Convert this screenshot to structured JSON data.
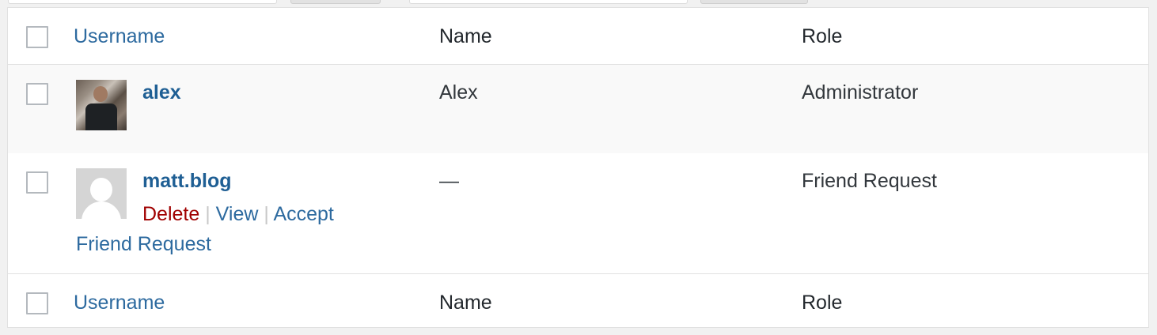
{
  "columns": {
    "username": "Username",
    "name": "Name",
    "role": "Role"
  },
  "rows": [
    {
      "username": "alex",
      "name": "Alex",
      "role": "Administrator",
      "avatar": "user-photo"
    },
    {
      "username": "matt.blog",
      "name": "—",
      "role": "Friend Request",
      "avatar": "default-avatar-icon",
      "actions": {
        "delete": "Delete",
        "view": "View",
        "accept": "Accept",
        "accept_cont": "Friend Request",
        "separator": "|"
      }
    }
  ],
  "colors": {
    "link": "#2d6a9f",
    "delete": "#a00000",
    "alt_row": "#f9f9f9"
  }
}
